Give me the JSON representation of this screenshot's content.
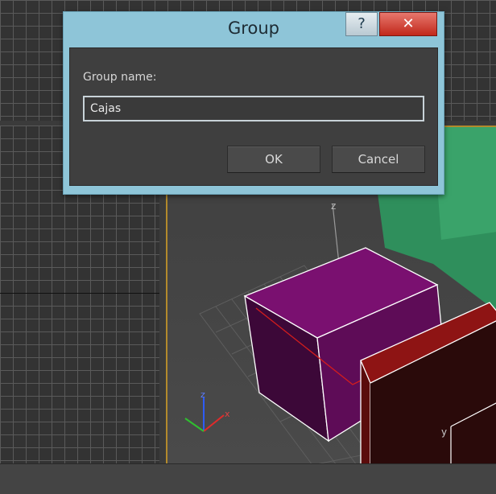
{
  "dialog": {
    "title": "Group",
    "help_label": "?",
    "close_label": "✕",
    "group_name_label": "Group name:",
    "group_name_value": "Cajas",
    "ok_label": "OK",
    "cancel_label": "Cancel"
  },
  "viewport": {
    "axis_label_z_main": "z",
    "axis_label_y_red": "y",
    "gizmo_z": "z",
    "gizmo_x": "x",
    "selection_color": "#ffffff",
    "box_colors": {
      "magenta": "#7a1070",
      "red": "#8e1414",
      "green": "#2f8f5c"
    },
    "active_viewport_border": "#b38a2c"
  }
}
